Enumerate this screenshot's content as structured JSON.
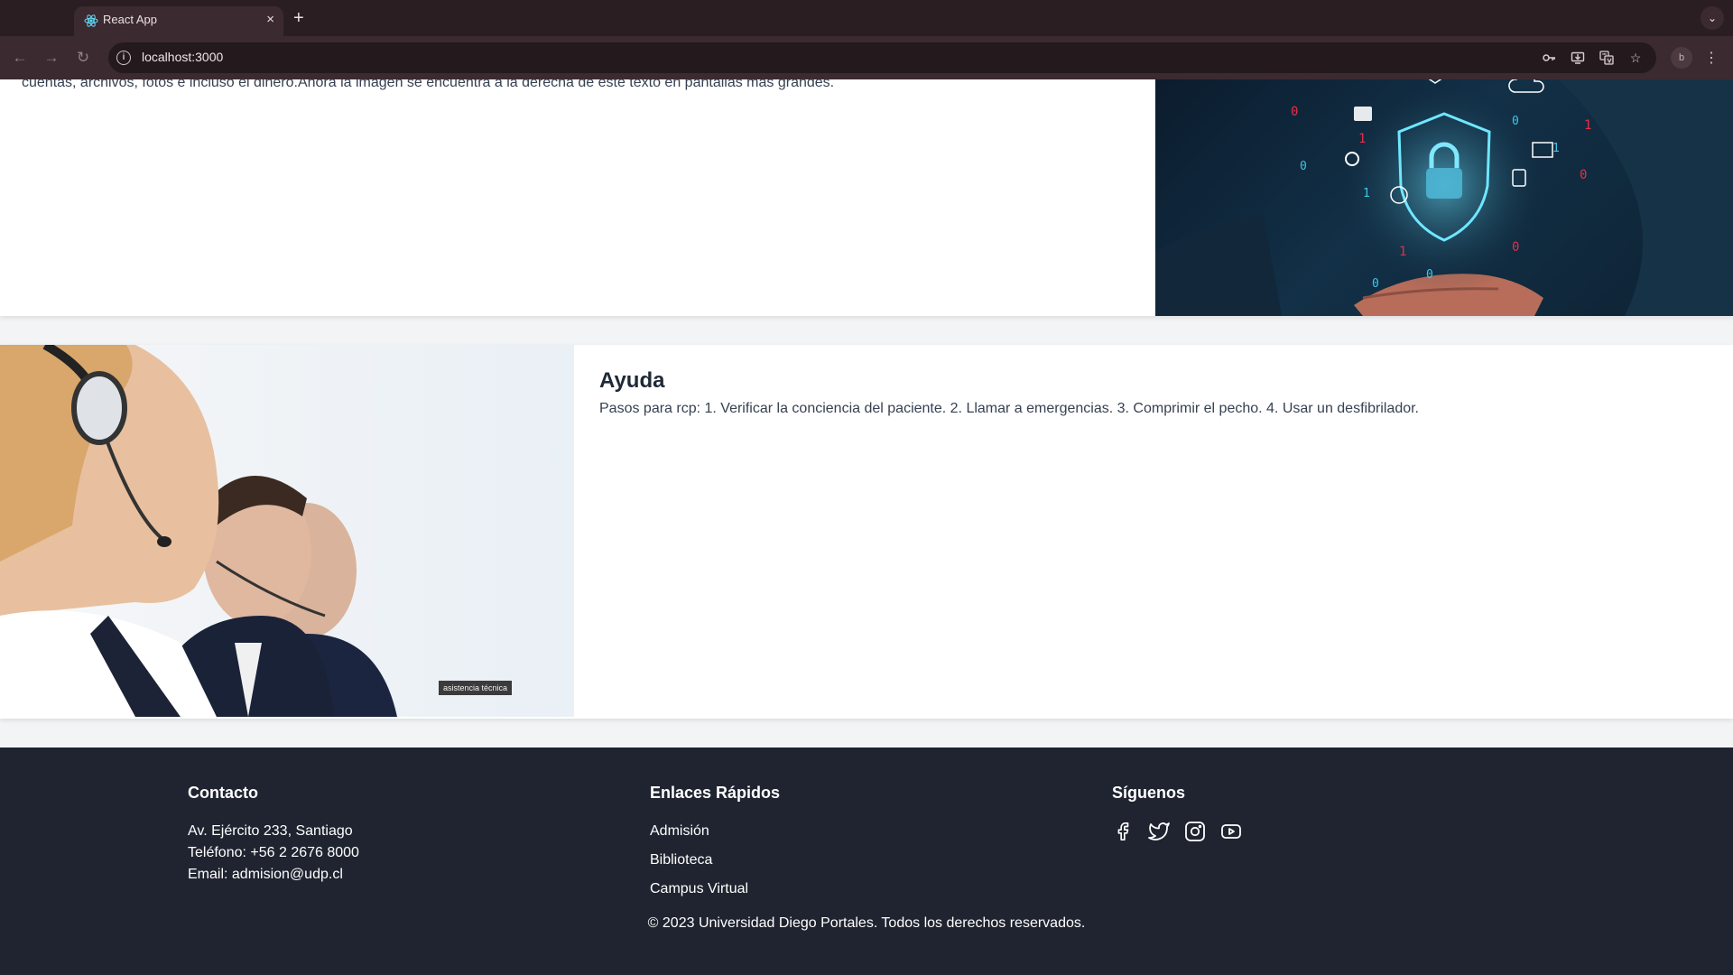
{
  "browser": {
    "tab_title": "React App",
    "tab_close": "×",
    "new_tab": "+",
    "url": "localhost:3000",
    "profile_initial": "b",
    "tab_menu": "⌄"
  },
  "security_card": {
    "text": "cuentas, archivos, fotos e incluso el dinero.Ahora la imagen se encuentra a la derecha de este texto en pantallas más grandes."
  },
  "help_card": {
    "title": "Ayuda",
    "text": "Pasos para rcp: 1. Verificar la conciencia del paciente. 2. Llamar a emergencias. 3. Comprimir el pecho. 4. Usar un desfibrilador.",
    "image_caption": "asistencia técnica"
  },
  "footer": {
    "contact": {
      "title": "Contacto",
      "address": "Av. Ejército 233, Santiago",
      "phone": "Teléfono: +56 2 2676 8000",
      "email": "Email: admision@udp.cl"
    },
    "links": {
      "title": "Enlaces Rápidos",
      "items": [
        "Admisión",
        "Biblioteca",
        "Campus Virtual"
      ]
    },
    "social": {
      "title": "Síguenos",
      "icons": [
        "facebook-icon",
        "twitter-icon",
        "instagram-icon",
        "youtube-icon"
      ]
    },
    "copyright": "© 2023 Universidad Diego Portales. Todos los derechos reservados."
  },
  "colors": {
    "footer_bg": "#1f2430",
    "chrome_bg": "#2b1e22",
    "toolbar_bg": "#3b2a2f"
  }
}
